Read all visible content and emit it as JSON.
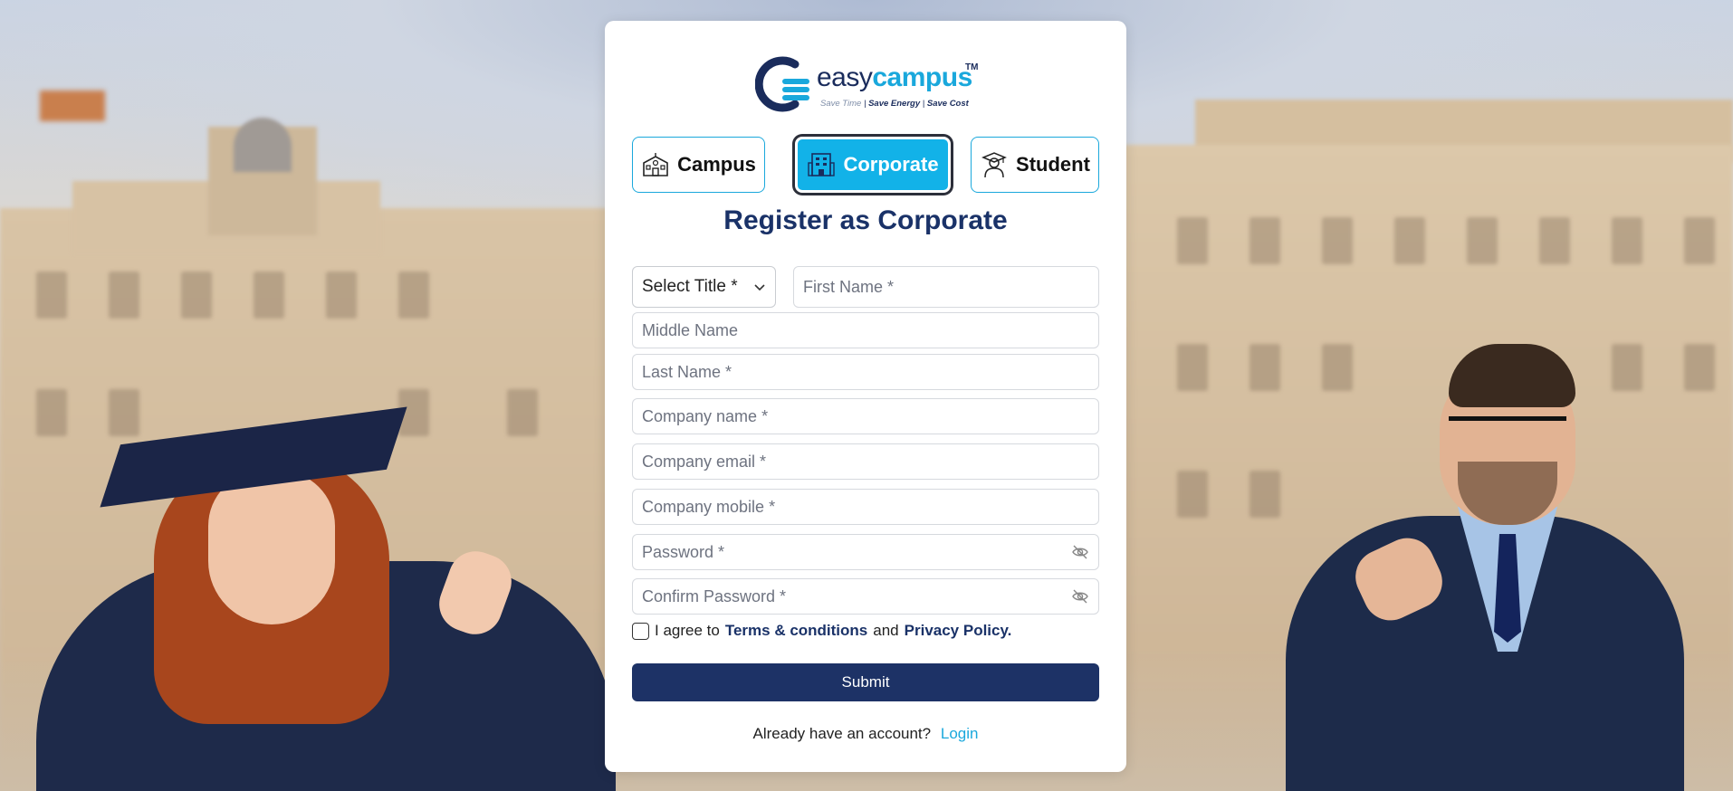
{
  "brand": {
    "name_prefix": "easy",
    "name_suffix": "campus",
    "trademark": "TM",
    "tagline_1": "Save Time",
    "tagline_2": "Save Energy",
    "tagline_3": "Save Cost"
  },
  "roles": [
    {
      "label": "Campus",
      "icon": "campus-building-icon",
      "selected": false
    },
    {
      "label": "Corporate",
      "icon": "corporate-building-icon",
      "selected": true
    },
    {
      "label": "Student",
      "icon": "student-icon",
      "selected": false
    }
  ],
  "form": {
    "heading": "Register as Corporate",
    "title_select": "Select Title *",
    "first_name_placeholder": "First Name *",
    "middle_name_placeholder": "Middle Name",
    "last_name_placeholder": "Last Name *",
    "company_name_placeholder": "Company name *",
    "company_email_placeholder": "Company email *",
    "company_mobile_placeholder": "Company mobile *",
    "password_placeholder": "Password *",
    "confirm_password_placeholder": "Confirm Password *",
    "agree_prefix": "I agree to",
    "terms_link": "Terms & conditions",
    "and_text": "and",
    "privacy_link": "Privacy Policy.",
    "submit_label": "Submit",
    "account_prompt": "Already have an account?",
    "login_link": "Login"
  },
  "colors": {
    "accent": "#12b2e8",
    "primary": "#1d3266"
  }
}
